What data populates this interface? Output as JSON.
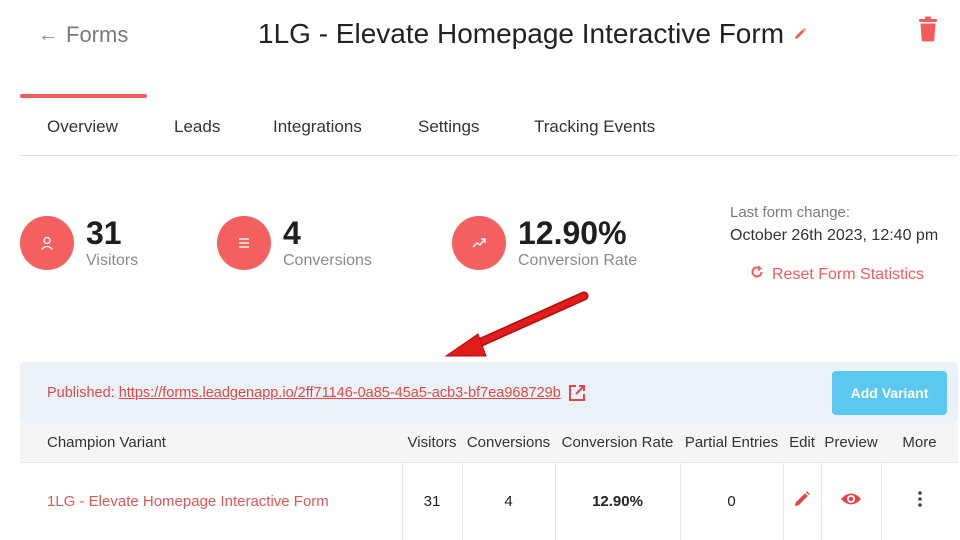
{
  "header": {
    "back_label": "Forms",
    "title": "1LG - Elevate Homepage Interactive Form"
  },
  "tabs": [
    {
      "label": "Overview",
      "active": true
    },
    {
      "label": "Leads"
    },
    {
      "label": "Integrations"
    },
    {
      "label": "Settings"
    },
    {
      "label": "Tracking Events"
    }
  ],
  "stats": {
    "visitors": {
      "value": "31",
      "label": "Visitors",
      "icon": "user-icon"
    },
    "conversions": {
      "value": "4",
      "label": "Conversions",
      "icon": "list-icon"
    },
    "conversion_rate": {
      "value": "12.90%",
      "label": "Conversion Rate",
      "icon": "trending-up-icon"
    }
  },
  "last_change": {
    "label": "Last form change:",
    "date": "October 26th 2023, 12:40 pm",
    "reset_label": "Reset Form Statistics"
  },
  "published": {
    "label": "Published:",
    "url": "https://forms.leadgenapp.io/2ff71146-0a85-45a5-acb3-bf7ea968729b",
    "add_variant_label": "Add Variant"
  },
  "table": {
    "columns": [
      "Champion Variant",
      "Visitors",
      "Conversions",
      "Conversion Rate",
      "Partial Entries",
      "Edit",
      "Preview",
      "More"
    ],
    "rows": [
      {
        "name": "1LG - Elevate Homepage Interactive Form",
        "visitors": "31",
        "conversions": "4",
        "conversion_rate": "12.90%",
        "partial_entries": "0"
      }
    ]
  },
  "colors": {
    "accent": "#f25c5c",
    "button_blue": "#5bc8f0",
    "published_bg": "#eaf2f8",
    "annotation_arrow": "#e21b1b"
  }
}
